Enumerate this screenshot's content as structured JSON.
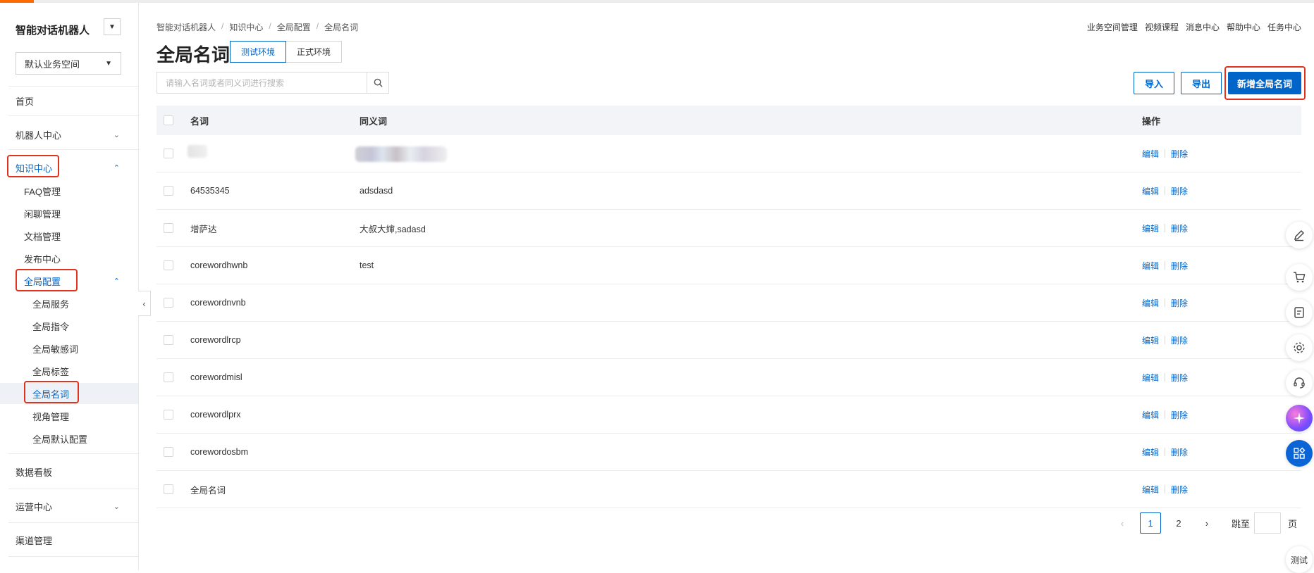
{
  "sidebar": {
    "app_title": "智能对话机器人",
    "workspace": "默认业务空间",
    "items": {
      "home": "首页",
      "robot_center": "机器人中心",
      "knowledge_center": "知识中心",
      "faq": "FAQ管理",
      "chitchat": "闲聊管理",
      "docs": "文档管理",
      "publish": "发布中心",
      "global_config": "全局配置",
      "global_service": "全局服务",
      "global_command": "全局指令",
      "global_sensitive": "全局敏感词",
      "global_tags": "全局标签",
      "global_terms": "全局名词",
      "perspective": "视角管理",
      "global_default": "全局默认配置",
      "dashboard": "数据看板",
      "ops_center": "运营中心",
      "channel": "渠道管理"
    }
  },
  "breadcrumb": [
    "智能对话机器人",
    "知识中心",
    "全局配置",
    "全局名词"
  ],
  "top_links": [
    "业务空间管理",
    "视频课程",
    "消息中心",
    "帮助中心",
    "任务中心"
  ],
  "page_title": "全局名词",
  "env_tabs": [
    "测试环境",
    "正式环境"
  ],
  "search": {
    "placeholder": "请输入名词或者同义词进行搜索"
  },
  "actions": {
    "import": "导入",
    "export": "导出",
    "add": "新增全局名词"
  },
  "table": {
    "headers": {
      "name": "名词",
      "synonyms": "同义词",
      "ops": "操作"
    },
    "edit_label": "编辑",
    "delete_label": "删除",
    "rows": [
      {
        "name": "",
        "synonyms": ""
      },
      {
        "name": "64535345",
        "synonyms": "adsdasd"
      },
      {
        "name": "增萨达",
        "synonyms": "大叔大婶,sadasd"
      },
      {
        "name": "corewordhwnb",
        "synonyms": "test"
      },
      {
        "name": "corewordnvnb",
        "synonyms": ""
      },
      {
        "name": "corewordlrcp",
        "synonyms": ""
      },
      {
        "name": "corewordmisl",
        "synonyms": ""
      },
      {
        "name": "corewordlprx",
        "synonyms": ""
      },
      {
        "name": "corewordosbm",
        "synonyms": ""
      },
      {
        "name": "全局名词",
        "synonyms": ""
      }
    ]
  },
  "pagination": {
    "prev": "‹",
    "pages": [
      "1",
      "2"
    ],
    "current": "1",
    "next": "›",
    "jump_label": "跳至",
    "page_unit": "页"
  },
  "floating": {
    "test_label": "测试"
  },
  "colors": {
    "accent": "#0064c8",
    "highlight": "#e0321c",
    "brand": "#ff6a00"
  }
}
